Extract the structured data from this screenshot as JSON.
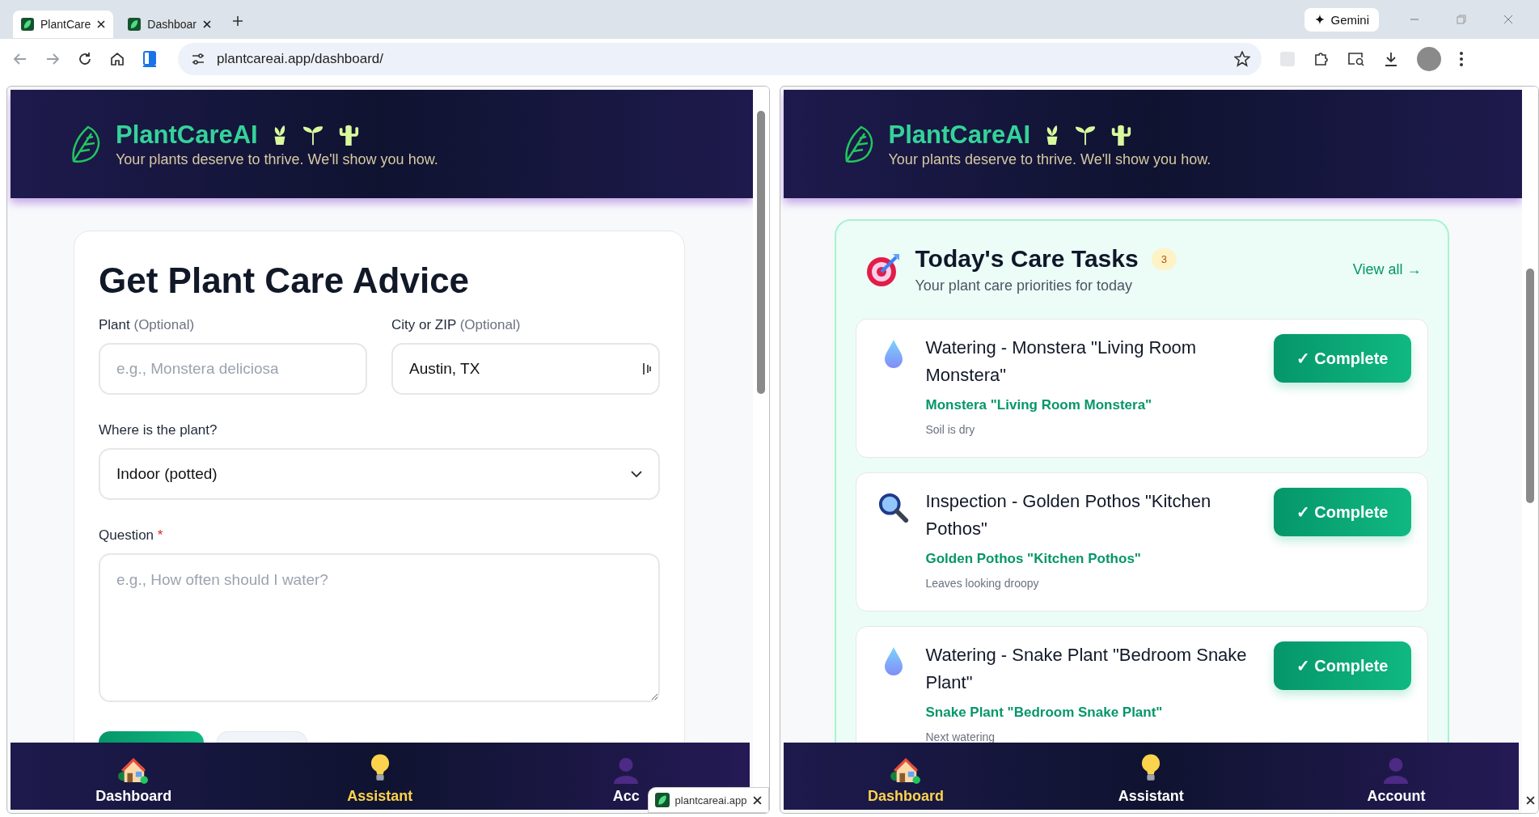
{
  "browser": {
    "tabs": [
      {
        "title": "PlantCare",
        "selected": true
      },
      {
        "title": "Dashboar",
        "selected": false
      }
    ],
    "gemini": "Gemini",
    "url": "plantcareai.app/dashboard/"
  },
  "left_pane": {
    "header": {
      "brand": "PlantCareAI",
      "tagline": "Your plants deserve to thrive. We'll show you how."
    },
    "form": {
      "title": "Get Plant Care Advice",
      "plant": {
        "label": "Plant",
        "hint": "(Optional)",
        "placeholder": "e.g., Monstera deliciosa"
      },
      "city": {
        "label": "City or ZIP",
        "hint": "(Optional)",
        "value": "Austin, TX"
      },
      "location": {
        "label": "Where is the plant?",
        "value": "Indoor (potted)"
      },
      "question": {
        "label": "Question",
        "required_mark": "*",
        "placeholder": "e.g., How often should I water?"
      }
    },
    "nav": [
      {
        "kind": "house",
        "label": "Dashboard",
        "selected": false
      },
      {
        "kind": "bulb",
        "label": "Assistant",
        "selected": true
      },
      {
        "kind": "person",
        "label": "Acc",
        "selected": false
      }
    ],
    "download_popup": {
      "label": "plantcareai.app"
    }
  },
  "right_pane": {
    "header": {
      "brand": "PlantCareAI",
      "tagline": "Your plants deserve to thrive. We'll show you how."
    },
    "tasks_card": {
      "title": "Today's Care Tasks",
      "count": "3",
      "subtitle": "Your plant care priorities for today",
      "view_all": "View all →",
      "tasks": [
        {
          "kind": "watering",
          "title": "Watering - Monstera \"Living Room Monstera\"",
          "plant": "Monstera \"Living Room Monstera\"",
          "note": "Soil is dry",
          "button": "✓ Complete"
        },
        {
          "kind": "inspection",
          "title": "Inspection - Golden Pothos \"Kitchen Pothos\"",
          "plant": "Golden Pothos \"Kitchen Pothos\"",
          "note": "Leaves looking droopy",
          "button": "✓ Complete"
        },
        {
          "kind": "watering",
          "title": "Watering - Snake Plant \"Bedroom Snake Plant\"",
          "plant": "Snake Plant \"Bedroom Snake Plant\"",
          "note": "Next watering",
          "button": "✓ Complete"
        }
      ]
    },
    "nav": [
      {
        "kind": "house",
        "label": "Dashboard",
        "selected": true
      },
      {
        "kind": "bulb",
        "label": "Assistant",
        "selected": false
      },
      {
        "kind": "person",
        "label": "Account",
        "selected": false
      }
    ]
  }
}
